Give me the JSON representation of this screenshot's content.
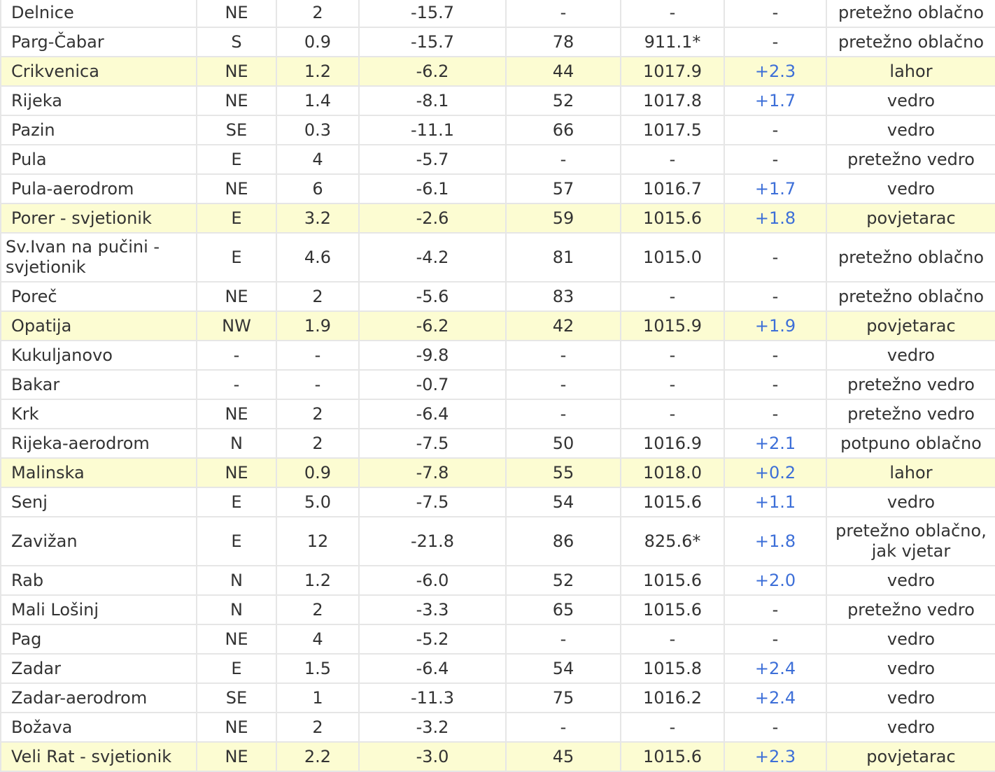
{
  "colors": {
    "highlight_row": "#fcfcd2",
    "grid_line": "#e6e6e6",
    "text": "#333333",
    "positive_tendency": "#3d6fd8"
  },
  "rows": [
    {
      "station": "Delnice",
      "wind_dir": "NE",
      "wind_speed": "2",
      "temp": "-15.7",
      "humidity": "-",
      "pressure": "-",
      "tendency": "-",
      "condition": "pretežno oblačno",
      "highlight": false
    },
    {
      "station": "Parg-Čabar",
      "wind_dir": "S",
      "wind_speed": "0.9",
      "temp": "-15.7",
      "humidity": "78",
      "pressure": "911.1*",
      "tendency": "-",
      "condition": "pretežno oblačno",
      "highlight": false
    },
    {
      "station": "Crikvenica",
      "wind_dir": "NE",
      "wind_speed": "1.2",
      "temp": "-6.2",
      "humidity": "44",
      "pressure": "1017.9",
      "tendency": "+2.3",
      "condition": "lahor",
      "highlight": true
    },
    {
      "station": "Rijeka",
      "wind_dir": "NE",
      "wind_speed": "1.4",
      "temp": "-8.1",
      "humidity": "52",
      "pressure": "1017.8",
      "tendency": "+1.7",
      "condition": "vedro",
      "highlight": false
    },
    {
      "station": "Pazin",
      "wind_dir": "SE",
      "wind_speed": "0.3",
      "temp": "-11.1",
      "humidity": "66",
      "pressure": "1017.5",
      "tendency": "-",
      "condition": "vedro",
      "highlight": false
    },
    {
      "station": "Pula",
      "wind_dir": "E",
      "wind_speed": "4",
      "temp": "-5.7",
      "humidity": "-",
      "pressure": "-",
      "tendency": "-",
      "condition": "pretežno vedro",
      "highlight": false
    },
    {
      "station": "Pula-aerodrom",
      "wind_dir": "NE",
      "wind_speed": "6",
      "temp": "-6.1",
      "humidity": "57",
      "pressure": "1016.7",
      "tendency": "+1.7",
      "condition": "vedro",
      "highlight": false
    },
    {
      "station": "Porer - svjetionik",
      "wind_dir": "E",
      "wind_speed": "3.2",
      "temp": "-2.6",
      "humidity": "59",
      "pressure": "1015.6",
      "tendency": "+1.8",
      "condition": "povjetarac",
      "highlight": true
    },
    {
      "station": "Sv.Ivan na pučini - svjetionik",
      "wind_dir": "E",
      "wind_speed": "4.6",
      "temp": "-4.2",
      "humidity": "81",
      "pressure": "1015.0",
      "tendency": "-",
      "condition": "pretežno oblačno",
      "highlight": false
    },
    {
      "station": "Poreč",
      "wind_dir": "NE",
      "wind_speed": "2",
      "temp": "-5.6",
      "humidity": "83",
      "pressure": "-",
      "tendency": "-",
      "condition": "pretežno oblačno",
      "highlight": false
    },
    {
      "station": "Opatija",
      "wind_dir": "NW",
      "wind_speed": "1.9",
      "temp": "-6.2",
      "humidity": "42",
      "pressure": "1015.9",
      "tendency": "+1.9",
      "condition": "povjetarac",
      "highlight": true
    },
    {
      "station": "Kukuljanovo",
      "wind_dir": "-",
      "wind_speed": "-",
      "temp": "-9.8",
      "humidity": "-",
      "pressure": "-",
      "tendency": "-",
      "condition": "vedro",
      "highlight": false
    },
    {
      "station": "Bakar",
      "wind_dir": "-",
      "wind_speed": "-",
      "temp": "-0.7",
      "humidity": "-",
      "pressure": "-",
      "tendency": "-",
      "condition": "pretežno vedro",
      "highlight": false
    },
    {
      "station": "Krk",
      "wind_dir": "NE",
      "wind_speed": "2",
      "temp": "-6.4",
      "humidity": "-",
      "pressure": "-",
      "tendency": "-",
      "condition": "pretežno vedro",
      "highlight": false
    },
    {
      "station": "Rijeka-aerodrom",
      "wind_dir": "N",
      "wind_speed": "2",
      "temp": "-7.5",
      "humidity": "50",
      "pressure": "1016.9",
      "tendency": "+2.1",
      "condition": "potpuno oblačno",
      "highlight": false
    },
    {
      "station": "Malinska",
      "wind_dir": "NE",
      "wind_speed": "0.9",
      "temp": "-7.8",
      "humidity": "55",
      "pressure": "1018.0",
      "tendency": "+0.2",
      "condition": "lahor",
      "highlight": true
    },
    {
      "station": "Senj",
      "wind_dir": "E",
      "wind_speed": "5.0",
      "temp": "-7.5",
      "humidity": "54",
      "pressure": "1015.6",
      "tendency": "+1.1",
      "condition": "vedro",
      "highlight": false
    },
    {
      "station": "Zavižan",
      "wind_dir": "E",
      "wind_speed": "12",
      "temp": "-21.8",
      "humidity": "86",
      "pressure": "825.6*",
      "tendency": "+1.8",
      "condition": "pretežno oblačno, jak vjetar",
      "highlight": false
    },
    {
      "station": "Rab",
      "wind_dir": "N",
      "wind_speed": "1.2",
      "temp": "-6.0",
      "humidity": "52",
      "pressure": "1015.6",
      "tendency": "+2.0",
      "condition": "vedro",
      "highlight": false
    },
    {
      "station": "Mali Lošinj",
      "wind_dir": "N",
      "wind_speed": "2",
      "temp": "-3.3",
      "humidity": "65",
      "pressure": "1015.6",
      "tendency": "-",
      "condition": "pretežno vedro",
      "highlight": false
    },
    {
      "station": "Pag",
      "wind_dir": "NE",
      "wind_speed": "4",
      "temp": "-5.2",
      "humidity": "-",
      "pressure": "-",
      "tendency": "-",
      "condition": "vedro",
      "highlight": false
    },
    {
      "station": "Zadar",
      "wind_dir": "E",
      "wind_speed": "1.5",
      "temp": "-6.4",
      "humidity": "54",
      "pressure": "1015.8",
      "tendency": "+2.4",
      "condition": "vedro",
      "highlight": false
    },
    {
      "station": "Zadar-aerodrom",
      "wind_dir": "SE",
      "wind_speed": "1",
      "temp": "-11.3",
      "humidity": "75",
      "pressure": "1016.2",
      "tendency": "+2.4",
      "condition": "vedro",
      "highlight": false
    },
    {
      "station": "Božava",
      "wind_dir": "NE",
      "wind_speed": "2",
      "temp": "-3.2",
      "humidity": "-",
      "pressure": "-",
      "tendency": "-",
      "condition": "vedro",
      "highlight": false
    },
    {
      "station": "Veli Rat - svjetionik",
      "wind_dir": "NE",
      "wind_speed": "2.2",
      "temp": "-3.0",
      "humidity": "45",
      "pressure": "1015.6",
      "tendency": "+2.3",
      "condition": "povjetarac",
      "highlight": true
    }
  ]
}
